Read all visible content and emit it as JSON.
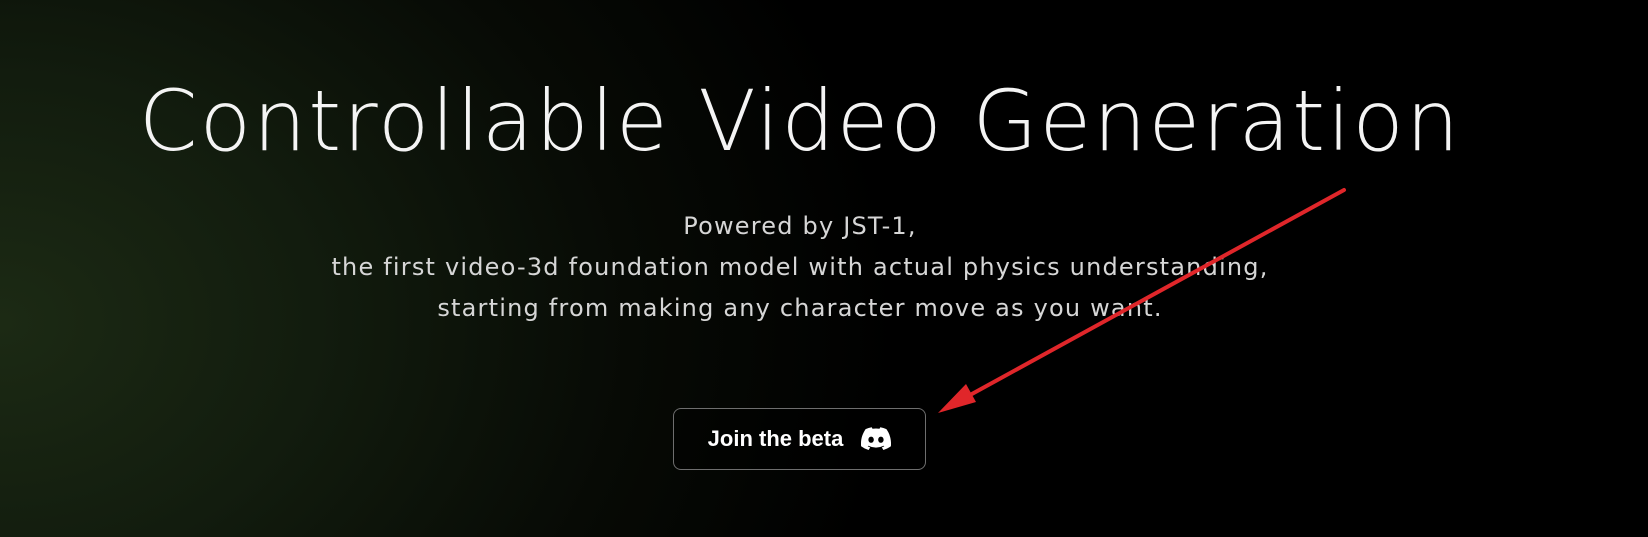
{
  "hero": {
    "title": "Controllable Video Generation",
    "subtitle_lines": [
      "Powered by JST-1,",
      "the first video-3d foundation model with actual physics understanding,",
      "starting from making any character move as you want."
    ]
  },
  "cta": {
    "label": "Join the beta",
    "icon": "discord-icon"
  },
  "annotation": {
    "icon": "red-arrow-annotation",
    "color": "#e0262a"
  },
  "colors": {
    "background_dark": "#000000",
    "background_green_tint": "#1c2a14",
    "button_border": "#6e6e6e"
  }
}
